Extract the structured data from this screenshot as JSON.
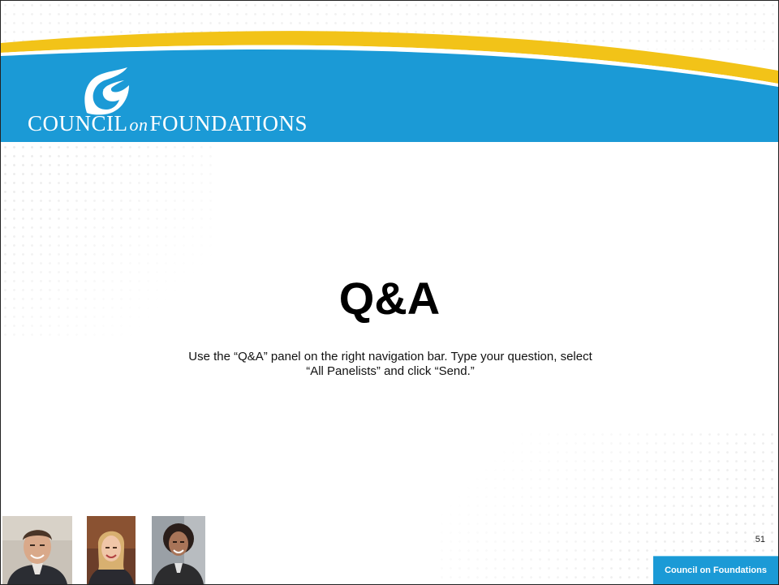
{
  "colors": {
    "banner_blue": "#1b9ad6",
    "stripe_yellow": "#f2c318",
    "text": "#000000"
  },
  "header": {
    "logo_icon": "flame-leaf-logo-icon",
    "org_name_part1": "COUNCIL",
    "org_name_connector": "on",
    "org_name_part2": "FOUNDATIONS"
  },
  "slide": {
    "title": "Q&A",
    "body": "Use the “Q&A” panel on the right navigation bar. Type your question, select “All Panelists” and click “Send.”",
    "page_number": "51"
  },
  "footer": {
    "badge_text": "Council on Foundations",
    "panelist_photos": [
      "panelist-photo-1",
      "panelist-photo-2",
      "panelist-photo-3"
    ]
  }
}
